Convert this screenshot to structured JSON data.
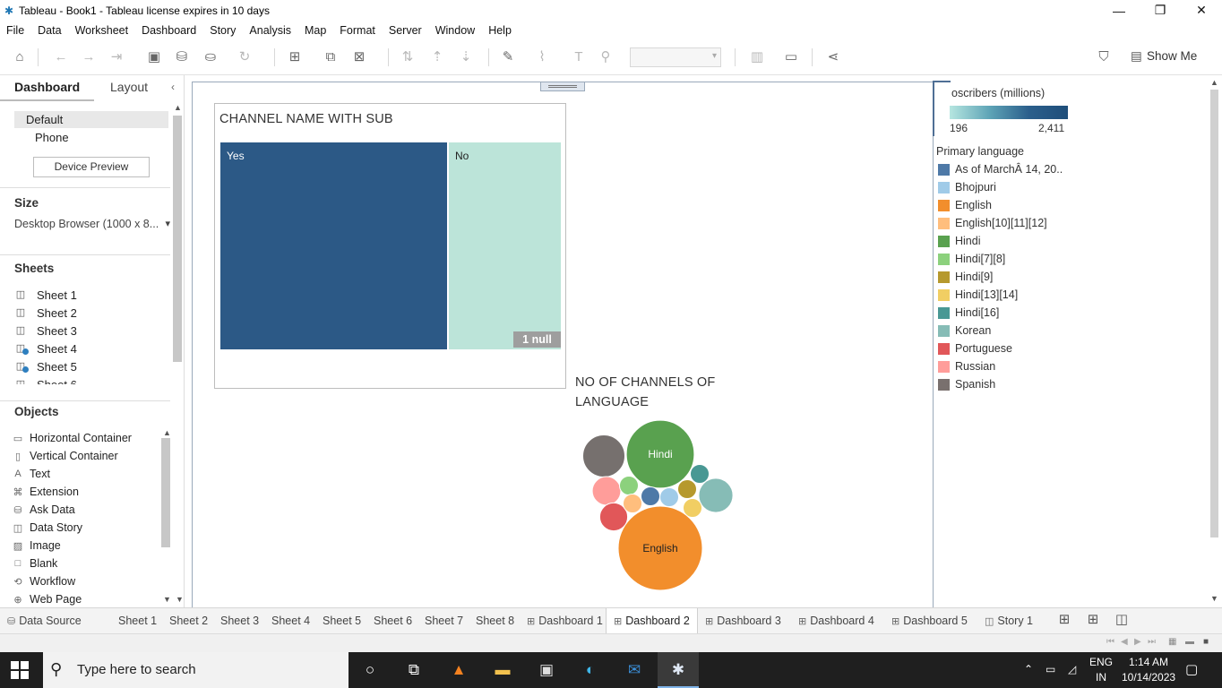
{
  "window": {
    "title": "Tableau - Book1 - Tableau license expires in 10 days",
    "controls": {
      "minimize": "—",
      "restore": "❐",
      "close": "✕"
    }
  },
  "menu": [
    "File",
    "Data",
    "Worksheet",
    "Dashboard",
    "Story",
    "Analysis",
    "Map",
    "Format",
    "Server",
    "Window",
    "Help"
  ],
  "toolbar": {
    "show_me": "Show Me"
  },
  "left_panel": {
    "tabs": {
      "dashboard": "Dashboard",
      "layout": "Layout"
    },
    "devices": [
      "Default",
      "Phone"
    ],
    "device_preview": "Device Preview",
    "size": {
      "title": "Size",
      "value": "Desktop Browser (1000 x 8..."
    },
    "sheets": {
      "title": "Sheets",
      "items": [
        {
          "label": "Sheet 1",
          "used": false
        },
        {
          "label": "Sheet 2",
          "used": false
        },
        {
          "label": "Sheet 3",
          "used": false
        },
        {
          "label": "Sheet 4",
          "used": true
        },
        {
          "label": "Sheet 5",
          "used": true
        },
        {
          "label": "Sheet 6",
          "used": false
        }
      ]
    },
    "objects": {
      "title": "Objects",
      "items": [
        {
          "label": "Horizontal Container",
          "icon": "horizontal-container-icon"
        },
        {
          "label": "Vertical Container",
          "icon": "vertical-container-icon"
        },
        {
          "label": "Text",
          "icon": "text-icon"
        },
        {
          "label": "Extension",
          "icon": "extension-icon"
        },
        {
          "label": "Ask Data",
          "icon": "ask-data-icon"
        },
        {
          "label": "Data Story",
          "icon": "data-story-icon"
        },
        {
          "label": "Image",
          "icon": "image-icon"
        },
        {
          "label": "Blank",
          "icon": "blank-icon"
        },
        {
          "label": "Workflow",
          "icon": "workflow-icon"
        },
        {
          "label": "Web Page",
          "icon": "web-page-icon"
        }
      ]
    }
  },
  "dashboard": {
    "treemap": {
      "title": "CHANNEL NAME WITH SUB",
      "yes": "Yes",
      "no": "No",
      "null_badge": "1 null",
      "colors": {
        "yes": "#2c5986",
        "no": "#bce4d9"
      }
    },
    "bubble_title": "NO OF CHANNELS OF LANGUAGE"
  },
  "chart_data": [
    {
      "type": "treemap",
      "title": "CHANNEL NAME WITH SUB",
      "categories": [
        "Yes",
        "No"
      ],
      "share": [
        0.67,
        0.33
      ],
      "annotation": "1 null"
    },
    {
      "type": "bubble",
      "title": "NO OF CHANNELS OF LANGUAGE",
      "bubbles": [
        {
          "label": "English",
          "color": "#f28e2c",
          "value": 20
        },
        {
          "label": "Hindi",
          "color": "#59a14f",
          "value": 13
        },
        {
          "label": "",
          "color": "#76706e",
          "value": 5
        },
        {
          "label": "",
          "color": "#86bcb6",
          "value": 3.3
        },
        {
          "label": "",
          "color": "#ff9d9a",
          "value": 2.3
        },
        {
          "label": "",
          "color": "#e15759",
          "value": 2.2
        },
        {
          "label": "",
          "color": "#499894",
          "value": 1
        },
        {
          "label": "",
          "color": "#b6992d",
          "value": 1
        },
        {
          "label": "",
          "color": "#4e79a7",
          "value": 1
        },
        {
          "label": "",
          "color": "#a0cbe8",
          "value": 1
        },
        {
          "label": "",
          "color": "#8cd17d",
          "value": 1
        },
        {
          "label": "",
          "color": "#ffbe7d",
          "value": 1
        },
        {
          "label": "",
          "color": "#f1ce63",
          "value": 1
        }
      ]
    }
  ],
  "legends": {
    "subscribers": {
      "title": "oscribers (millions)",
      "min": "196",
      "max": "2,411"
    },
    "language": {
      "title": "Primary language",
      "items": [
        {
          "label": "As of MarchÂ 14, 20..",
          "color": "#4e79a7"
        },
        {
          "label": "Bhojpuri",
          "color": "#a0cbe8"
        },
        {
          "label": "English",
          "color": "#f28e2c"
        },
        {
          "label": "English[10][11][12]",
          "color": "#ffbe7d"
        },
        {
          "label": "Hindi",
          "color": "#59a14f"
        },
        {
          "label": "Hindi[7][8]",
          "color": "#8cd17d"
        },
        {
          "label": "Hindi[9]",
          "color": "#b6992d"
        },
        {
          "label": "Hindi[13][14]",
          "color": "#f1ce63"
        },
        {
          "label": "Hindi[16]",
          "color": "#499894"
        },
        {
          "label": "Korean",
          "color": "#86bcb6"
        },
        {
          "label": "Portuguese",
          "color": "#e15759"
        },
        {
          "label": "Russian",
          "color": "#ff9d9a"
        },
        {
          "label": "Spanish",
          "color": "#79706e"
        }
      ]
    }
  },
  "sheet_tabs": [
    {
      "label": "Data Source",
      "icon": "data-source-icon",
      "glyph": "⛁"
    },
    {
      "label": "Sheet 1"
    },
    {
      "label": "Sheet 2"
    },
    {
      "label": "Sheet 3"
    },
    {
      "label": "Sheet 4"
    },
    {
      "label": "Sheet 5"
    },
    {
      "label": "Sheet 6"
    },
    {
      "label": "Sheet 7"
    },
    {
      "label": "Sheet 8"
    },
    {
      "label": "Dashboard 1",
      "icon": "dashboard-icon",
      "glyph": "⊞"
    },
    {
      "label": "Dashboard 2",
      "icon": "dashboard-icon",
      "glyph": "⊞",
      "active": true
    },
    {
      "label": "Dashboard 3",
      "icon": "dashboard-icon",
      "glyph": "⊞"
    },
    {
      "label": "Dashboard 4",
      "icon": "dashboard-icon",
      "glyph": "⊞"
    },
    {
      "label": "Dashboard 5",
      "icon": "dashboard-icon",
      "glyph": "⊞"
    },
    {
      "label": "Story 1",
      "icon": "story-icon",
      "glyph": "◫"
    }
  ],
  "taskbar": {
    "search_placeholder": "Type here to search",
    "lang_top": "ENG",
    "lang_bottom": "IN",
    "time": "1:14 AM",
    "date": "10/14/2023"
  }
}
